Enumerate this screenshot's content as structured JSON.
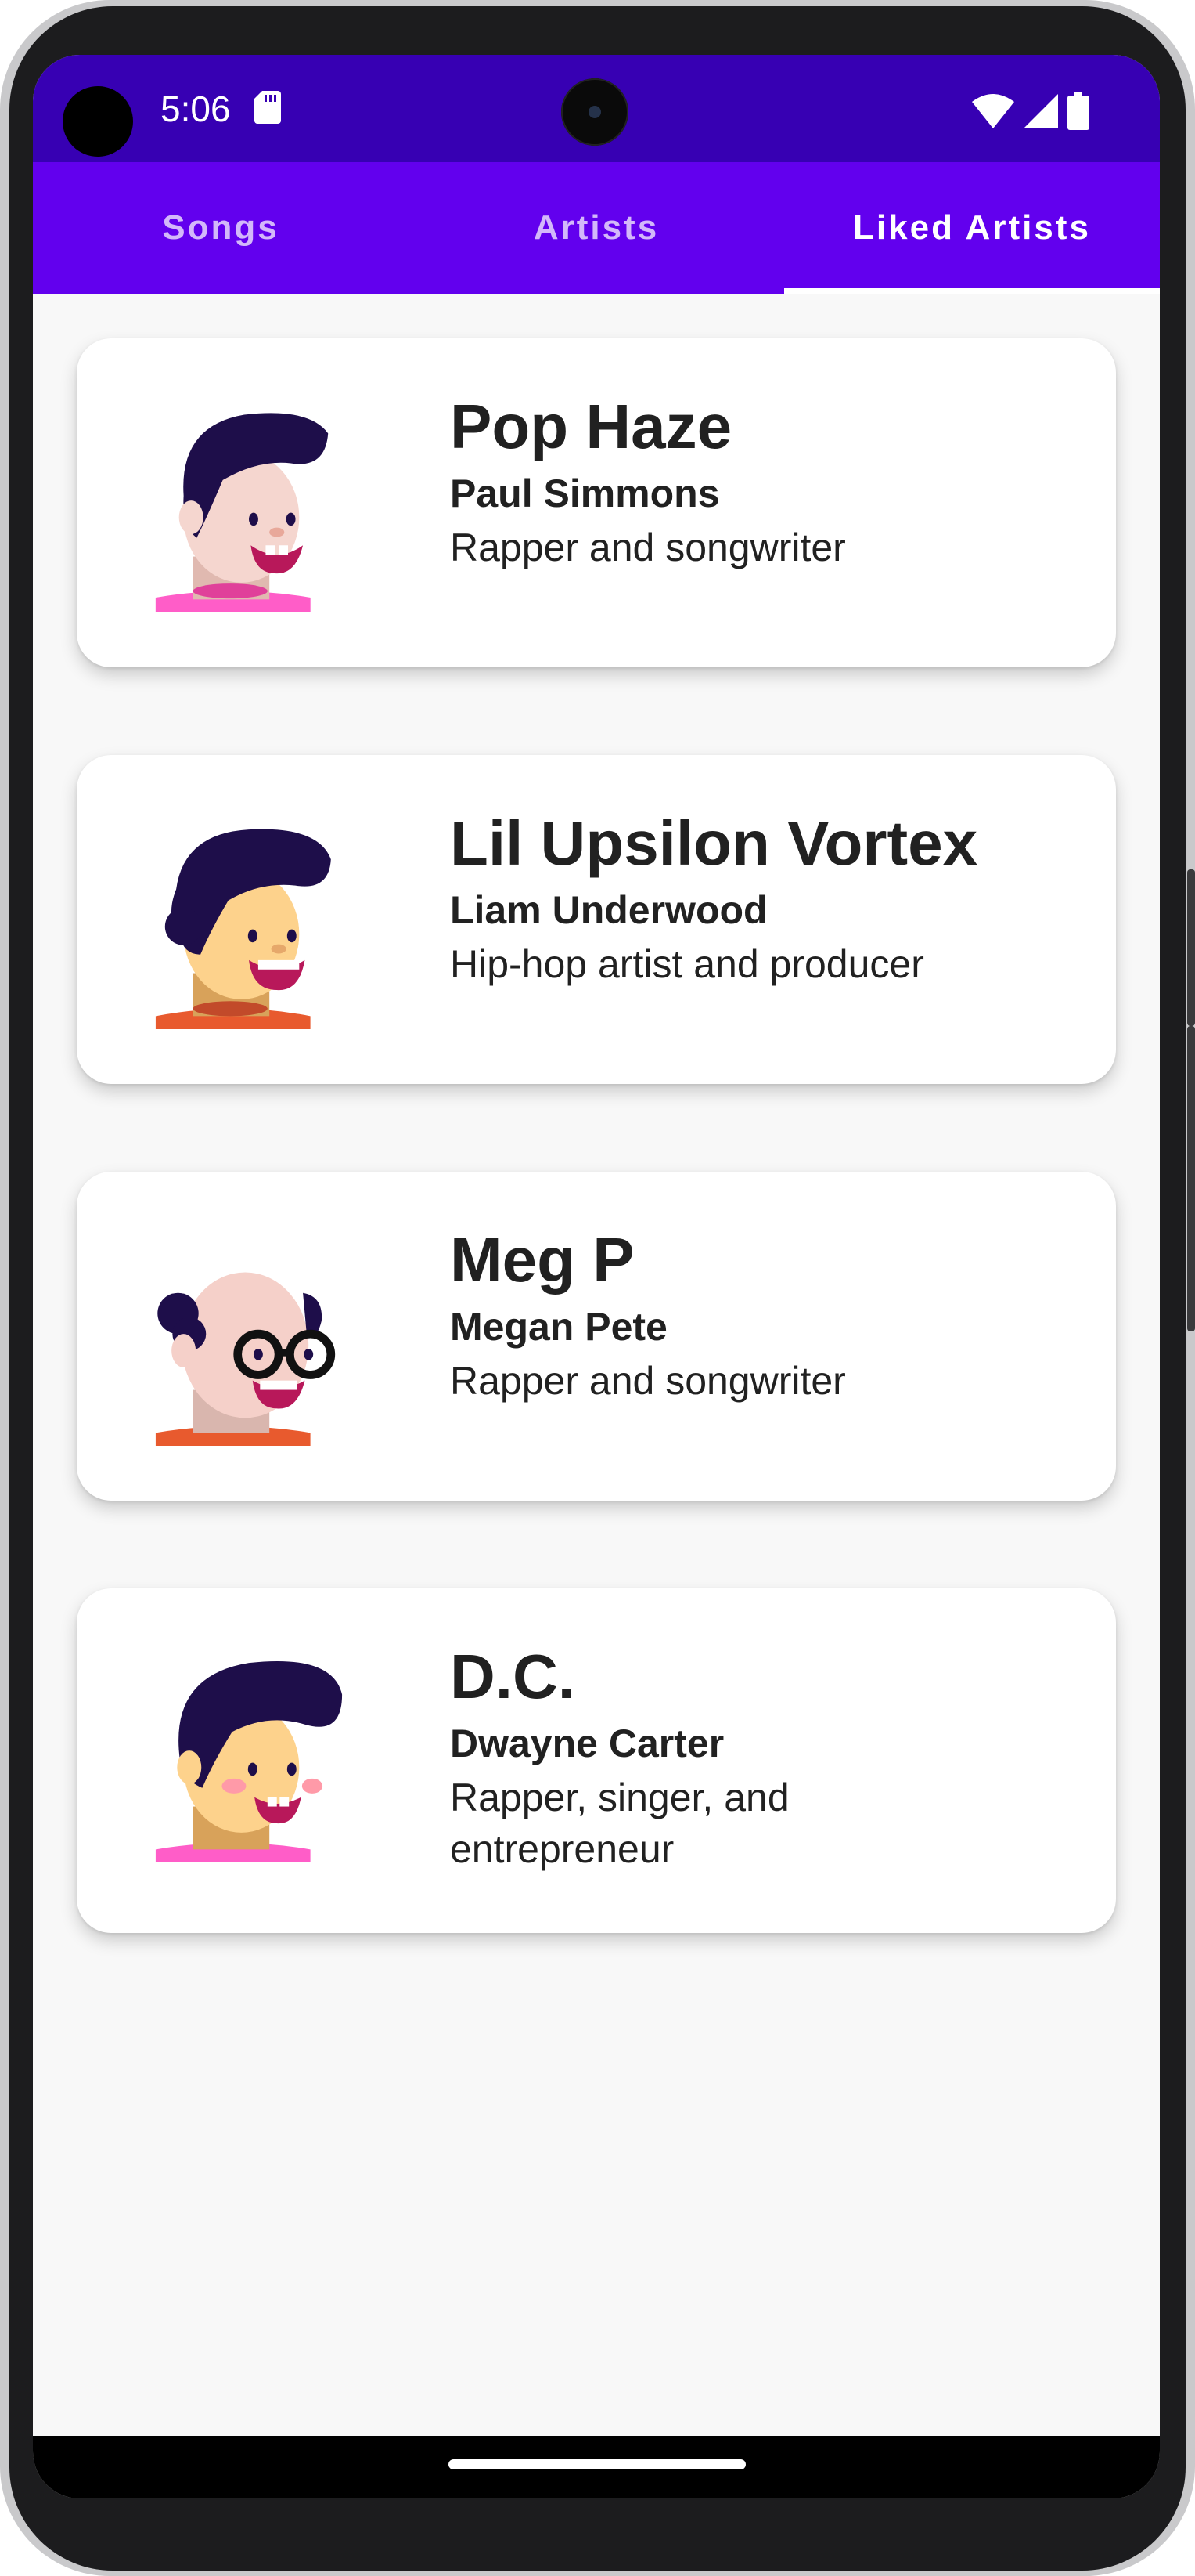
{
  "status_bar": {
    "time": "5:06",
    "icons": [
      "sd-card-icon",
      "wifi-icon",
      "signal-icon",
      "battery-icon"
    ]
  },
  "tabs": [
    {
      "label": "Songs",
      "active": false
    },
    {
      "label": "Artists",
      "active": false
    },
    {
      "label": "Liked Artists",
      "active": true
    }
  ],
  "artists": [
    {
      "stage_name": "Pop Haze",
      "real_name": "Paul Simmons",
      "description": "Rapper and songwriter",
      "avatar": "avatar-pop-haze-icon"
    },
    {
      "stage_name": "Lil Upsilon Vortex",
      "real_name": "Liam Underwood",
      "description": "Hip-hop artist and producer",
      "avatar": "avatar-lil-upsilon-vortex-icon"
    },
    {
      "stage_name": "Meg P",
      "real_name": "Megan Pete",
      "description": "Rapper and songwriter",
      "avatar": "avatar-meg-p-icon"
    },
    {
      "stage_name": "D.C.",
      "real_name": "Dwayne Carter",
      "description": "Rapper, singer, and entrepreneur",
      "avatar": "avatar-dc-icon"
    }
  ],
  "colors": {
    "status_bar": "#3700b3",
    "tab_bar": "#6200ee",
    "background": "#f8f8f8",
    "card": "#ffffff",
    "text": "#212121"
  }
}
